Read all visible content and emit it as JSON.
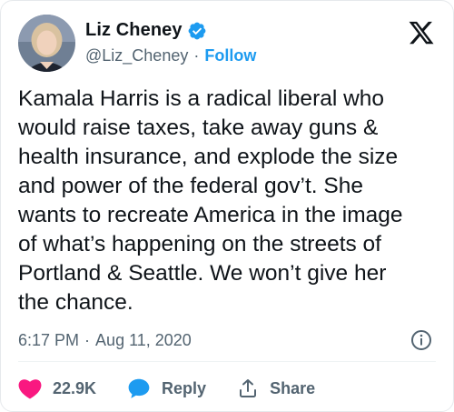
{
  "author": {
    "name": "Liz Cheney",
    "handle": "@Liz_Cheney",
    "separator": "·",
    "follow_label": "Follow",
    "verified": true,
    "avatar_icon": "profile-photo"
  },
  "tweet": {
    "text": "Kamala Harris is a radical liberal who\nwould raise taxes, take away guns &\nhealth insurance, and explode the size\nand power of the federal gov’t. She\nwants to recreate America in the image\nof what’s happening on the streets of\nPortland & Seattle. We won’t give her\nthe chance.",
    "time": "6:17 PM",
    "separator": "·",
    "date": "Aug 11, 2020"
  },
  "actions": {
    "like_count": "22.9K",
    "reply_label": "Reply",
    "share_label": "Share"
  },
  "icons": {
    "logo": "x-logo-icon",
    "verified": "verified-badge-icon",
    "info": "info-icon",
    "like": "heart-icon",
    "reply": "reply-bubble-icon",
    "share": "share-icon"
  },
  "colors": {
    "accent": "#1d9bf0",
    "like": "#f91880",
    "text": "#0f1419",
    "secondary": "#536471"
  }
}
